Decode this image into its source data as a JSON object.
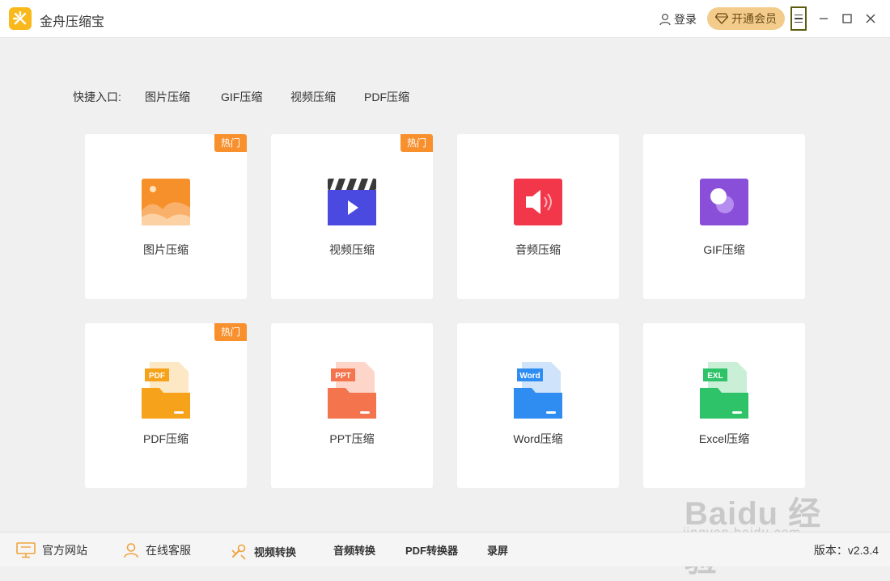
{
  "app": {
    "title": "金舟压缩宝"
  },
  "header": {
    "login": "登录",
    "vip": "开通会员"
  },
  "quick": {
    "label": "快捷入口:",
    "links": [
      "图片压缩",
      "GIF压缩",
      "视频压缩",
      "PDF压缩"
    ]
  },
  "cards": [
    {
      "label": "图片压缩",
      "badge": "热门",
      "icon": "image-icon",
      "color": "#f6902b"
    },
    {
      "label": "视频压缩",
      "badge": "热门",
      "icon": "video-icon",
      "color": "#4a4ae0"
    },
    {
      "label": "音频压缩",
      "badge": "",
      "icon": "audio-icon",
      "color": "#f2374a"
    },
    {
      "label": "GIF压缩",
      "badge": "",
      "icon": "gif-icon",
      "color": "#8a4fd8"
    },
    {
      "label": "PDF压缩",
      "badge": "热门",
      "icon": "pdf-file-icon",
      "tag": "PDF",
      "color": "#f7a21b"
    },
    {
      "label": "PPT压缩",
      "badge": "",
      "icon": "ppt-file-icon",
      "tag": "PPT",
      "color": "#f4744d"
    },
    {
      "label": "Word压缩",
      "badge": "",
      "icon": "word-file-icon",
      "tag": "Word",
      "color": "#2f8df2"
    },
    {
      "label": "Excel压缩",
      "badge": "",
      "icon": "excel-file-icon",
      "tag": "EXL",
      "color": "#2ec269"
    }
  ],
  "footer": {
    "items": [
      "官方网站",
      "在线客服",
      "视频转换",
      "音频转换",
      "PDF转换器",
      "录屏"
    ],
    "version": "版本：v2.3.4"
  },
  "watermark": {
    "main": "Baidu 经验",
    "sub": "jingyan.baidu.com"
  }
}
